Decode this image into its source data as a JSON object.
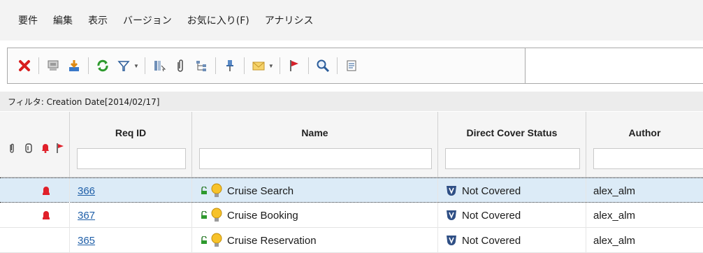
{
  "menu": {
    "items": [
      "要件",
      "編集",
      "表示",
      "バージョン",
      "お気に入り(F)",
      "アナリシス"
    ]
  },
  "toolbar": {
    "buttons": [
      {
        "icon": "delete-icon"
      },
      {
        "icon": "monitor-icon"
      },
      {
        "icon": "download-icon"
      },
      {
        "icon": "refresh-icon"
      },
      {
        "icon": "filter-icon"
      },
      {
        "icon": "column-select-icon"
      },
      {
        "icon": "attachment-icon"
      },
      {
        "icon": "hierarchy-icon"
      },
      {
        "icon": "pin-icon"
      },
      {
        "icon": "mail-icon"
      },
      {
        "icon": "flag-icon"
      },
      {
        "icon": "find-icon"
      },
      {
        "icon": "notes-icon"
      }
    ]
  },
  "filter": {
    "label": "フィルタ: Creation Date[2014/02/17]"
  },
  "grid": {
    "columns": {
      "req_id": "Req ID",
      "name": "Name",
      "cover_status": "Direct Cover Status",
      "author": "Author"
    },
    "rows": [
      {
        "req_id": "366",
        "name": "Cruise Search",
        "status": "Not Covered",
        "author": "alex_alm",
        "alert": true,
        "selected": true
      },
      {
        "req_id": "367",
        "name": "Cruise Booking",
        "status": "Not Covered",
        "author": "alex_alm",
        "alert": true,
        "selected": false
      },
      {
        "req_id": "365",
        "name": "Cruise Reservation",
        "status": "Not Covered",
        "author": "alex_alm",
        "alert": false,
        "selected": false
      }
    ]
  },
  "colors": {
    "selection": "#dcebf7",
    "link": "#1f5fa8",
    "alert": "#e0202a"
  }
}
